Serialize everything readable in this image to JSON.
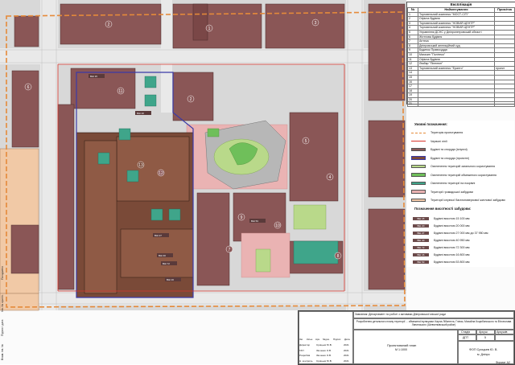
{
  "explication": {
    "title": "Експлікація",
    "headers": [
      "№",
      "Найменування",
      "Примітка"
    ],
    "rows": [
      {
        "n": "1",
        "name": "Торговельний комплекс \"МОСТ-СІТІ\"",
        "note": ""
      },
      {
        "n": "2",
        "name": "Офісна будівля",
        "note": ""
      },
      {
        "n": "3",
        "name": "Торговельний комплекс \"НОВИЙ ЦЕНТР\"",
        "note": ""
      },
      {
        "n": "4",
        "name": "Торговельний комплекс \"НОВИЙ ЦЕНТР\"",
        "note": ""
      },
      {
        "n": "5",
        "name": "Управління ДСНС у Дніпропетровській області",
        "note": ""
      },
      {
        "n": "6",
        "name": "Житлова будівля",
        "note": ""
      },
      {
        "n": "7",
        "name": "Аптека",
        "note": ""
      },
      {
        "n": "8",
        "name": "Дніпровський апеляційний суд",
        "note": ""
      },
      {
        "n": "9",
        "name": "Будинок Правосуддя",
        "note": ""
      },
      {
        "n": "10",
        "name": "Магазин \"Політеко\"",
        "note": ""
      },
      {
        "n": "11",
        "name": "Офісна будівля",
        "note": ""
      },
      {
        "n": "12",
        "name": "Лімбар \"Пінелюн\"",
        "note": ""
      },
      {
        "n": "13",
        "name": "Торговельний комплекс \"Ерапто\"",
        "note": "проект"
      },
      {
        "n": "14",
        "name": "",
        "note": ""
      },
      {
        "n": "15",
        "name": "",
        "note": ""
      },
      {
        "n": "16",
        "name": "",
        "note": ""
      },
      {
        "n": "17",
        "name": "",
        "note": ""
      },
      {
        "n": "18",
        "name": "",
        "note": ""
      },
      {
        "n": "19",
        "name": "",
        "note": ""
      },
      {
        "n": "20",
        "name": "",
        "note": ""
      },
      {
        "n": "21",
        "name": "",
        "note": ""
      }
    ]
  },
  "legend": {
    "title": "Умовні позначення:",
    "items": [
      {
        "label": "Територія проектування",
        "color": "#e58a3a",
        "style": "dashed-line"
      },
      {
        "label": "Червоні лінії",
        "color": "#d9352b",
        "style": "line"
      },
      {
        "label": "Будівлі та споруди (існуючі)",
        "color": "#8b5a5a",
        "style": "fill"
      },
      {
        "label": "Будівлі та споруди (проектні)",
        "color": "#7a4a3a",
        "style": "fill-outline"
      },
      {
        "label": "Озеленення територій загального користування",
        "color": "#b9d98a",
        "style": "fill"
      },
      {
        "label": "Озеленення територій обмеженого користування",
        "color": "#6fbf5a",
        "style": "fill"
      },
      {
        "label": "Озеленення території на покрівлі",
        "color": "#3fa58a",
        "style": "fill"
      },
      {
        "label": "Території громадської забудови",
        "color": "#e9b2b2",
        "style": "fill"
      },
      {
        "label": "Території існуючої багатоповерхової житлової забудови",
        "color": "#f3c9a8",
        "style": "fill"
      }
    ]
  },
  "heights": {
    "title": "Позначення висотності забудови:",
    "items": [
      {
        "badge": "ВШ 15",
        "label": "Будівлі висотою 15 100 мм"
      },
      {
        "badge": "ВШ 20",
        "label": "Будівлі висотою 20 000 мм"
      },
      {
        "badge": "ВШ 27",
        "label": "Будівлі висотою 27 000 мм до 37 950 мм"
      },
      {
        "badge": "ВШ 40",
        "label": "Будівлі висотою 40 950 мм"
      },
      {
        "badge": "ВШ 72",
        "label": "Будівлі висотою 72 300 мм"
      },
      {
        "badge": "ВШ 16",
        "label": "Будівлі висотою 16 800 мм"
      },
      {
        "badge": "ВШ 53",
        "label": "Будівлі висотою 53 800 мм"
      }
    ]
  },
  "stamp": {
    "customer": "Замовник: Департамент по роботі з активами Дніпровської міської ради",
    "project": "Розроблення детального плану території ... обмеженої вулицями: Карла Лібкнехта, Глінки, Михайла Коцюбинського та В'ячеслава Липинського (Шевченківський район)",
    "sheet_title": "Проектований план",
    "scale": "М 1:1000",
    "stage_label": "Стадія",
    "stage": "ДПТ",
    "sheet_label": "Аркуш",
    "sheet": "5",
    "sheets_label": "Аркушів",
    "company": "ФОП Срицьев Ю. В.",
    "city": "м. Дніпро",
    "roles": [
      {
        "role": "Директор",
        "name": "Срицьев Ю.В.",
        "year": "2021"
      },
      {
        "role": "ГАП",
        "name": "Зінченко О.В.",
        "year": "2021"
      },
      {
        "role": "Розробив",
        "name": "Зінченко О.В.",
        "year": "2021"
      },
      {
        "role": "Н. контроль",
        "name": "Срицьев Ю.В.",
        "year": "2021"
      }
    ],
    "cols": [
      "Зм.",
      "Кільк.",
      "Арк.",
      "№док.",
      "Підпис",
      "Дата"
    ]
  },
  "format": "Формат А2",
  "side_labels": [
    "Погоджено",
    "Інв. № оригін.",
    "Підпис і дата",
    "Взам. інв. №"
  ],
  "map": {
    "block_numbers": [
      "1",
      "2",
      "2",
      "3",
      "4",
      "5",
      "6",
      "7",
      "8",
      "9",
      "10",
      "11",
      "12",
      "13"
    ],
    "height_labels": [
      "ВШ 15",
      "ВШ 20",
      "ВШ 27",
      "ВШ 40",
      "ВШ 72",
      "ВШ 16",
      "ВШ 53"
    ]
  }
}
